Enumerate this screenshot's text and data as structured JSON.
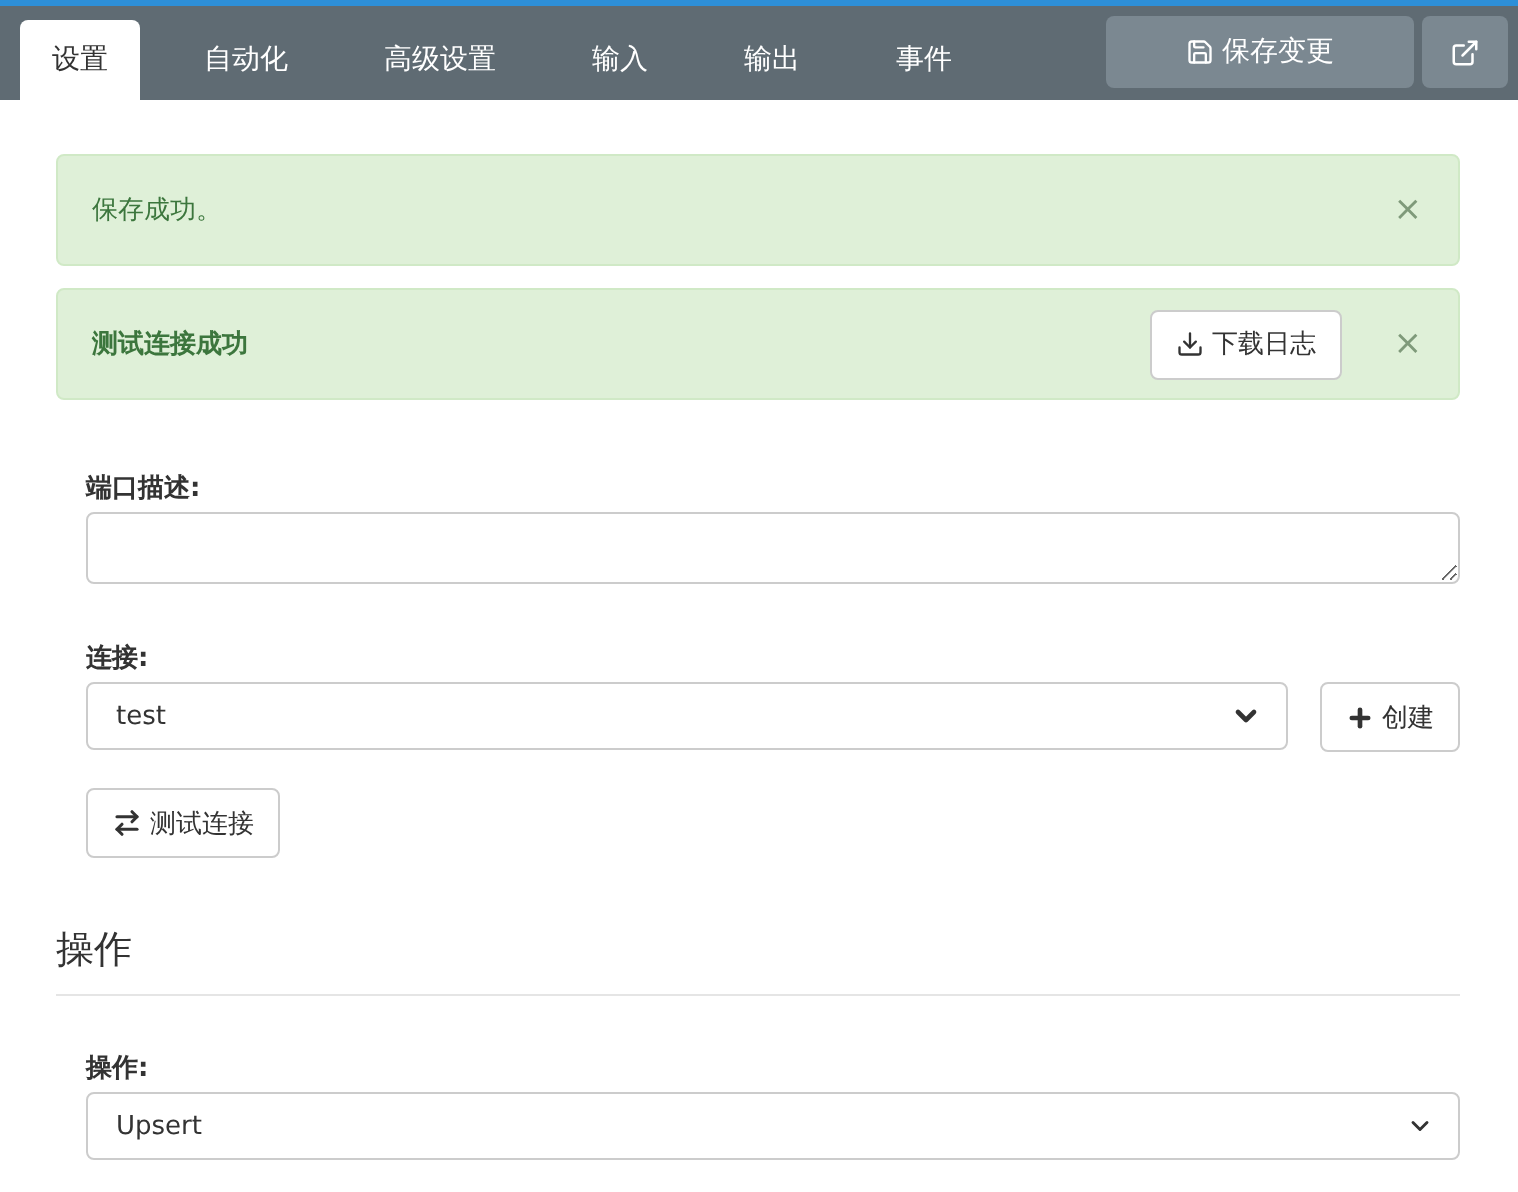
{
  "tabs": [
    {
      "label": "设置",
      "selected": true
    },
    {
      "label": "自动化",
      "selected": false
    },
    {
      "label": "高级设置",
      "selected": false
    },
    {
      "label": "输入",
      "selected": false
    },
    {
      "label": "输出",
      "selected": false
    },
    {
      "label": "事件",
      "selected": false
    }
  ],
  "save_button": "保存变更",
  "alerts": [
    {
      "text": "保存成功。",
      "bold": false,
      "close": "×"
    },
    {
      "text": "测试连接成功",
      "bold": true,
      "button": "下载日志",
      "close": "×"
    }
  ],
  "description": {
    "label": "端口描述:"
  },
  "connection": {
    "label": "连接:",
    "value": "test",
    "create_button": "创建"
  },
  "test_button": "测试连接",
  "operation_section": {
    "heading": "操作",
    "label": "操作:",
    "value": "Upsert"
  }
}
